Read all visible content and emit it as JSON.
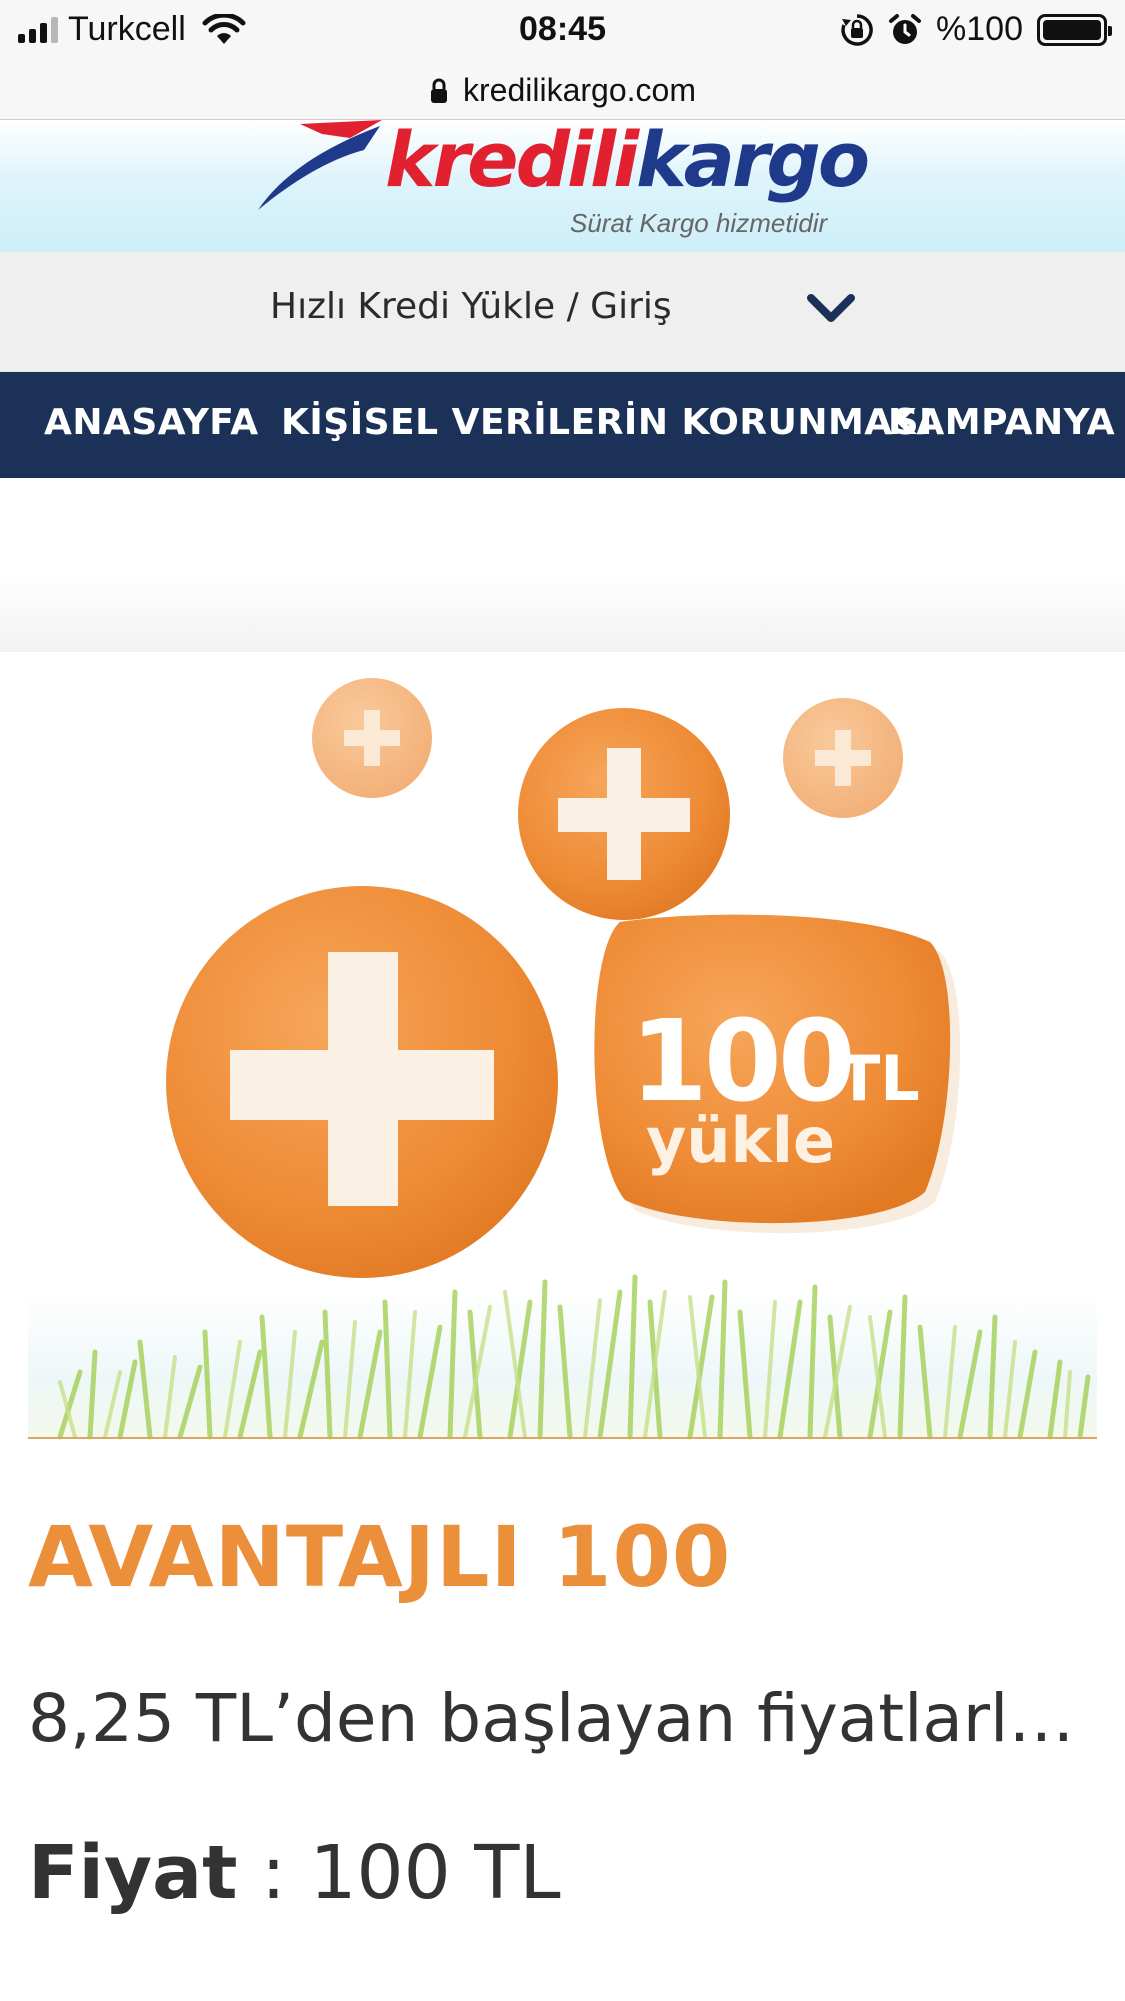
{
  "status_bar": {
    "carrier": "Turkcell",
    "time": "08:45",
    "battery": "%100",
    "signal_bars_active": 3,
    "signal_bars_total": 4
  },
  "browser": {
    "url": "kredilikargo.com"
  },
  "logo": {
    "part1": "kredili",
    "part2": "kargo",
    "tagline": "Sürat Kargo hizmetidir",
    "colors": {
      "red": "#e1212f",
      "blue": "#1f3a8a"
    }
  },
  "quick_credit": {
    "label": "Hızlı Kredi Yükle / Giriş"
  },
  "nav": {
    "items": [
      "ANASAYFA",
      "KİŞİSEL VERİLERİN KORUNMASI",
      "KAMPANYA"
    ],
    "background": "#1b3157"
  },
  "banner": {
    "amount": "100",
    "currency": "TL",
    "action": "yükle",
    "accent": "#ee8f38"
  },
  "product": {
    "title": "AVANTAJLI 100",
    "description": "8,25 TL’den başlayan fiyatlarla...",
    "price_label": "Fiyat",
    "price_separator": " : ",
    "price_value": "100 TL",
    "title_color": "#eb8f3a"
  }
}
